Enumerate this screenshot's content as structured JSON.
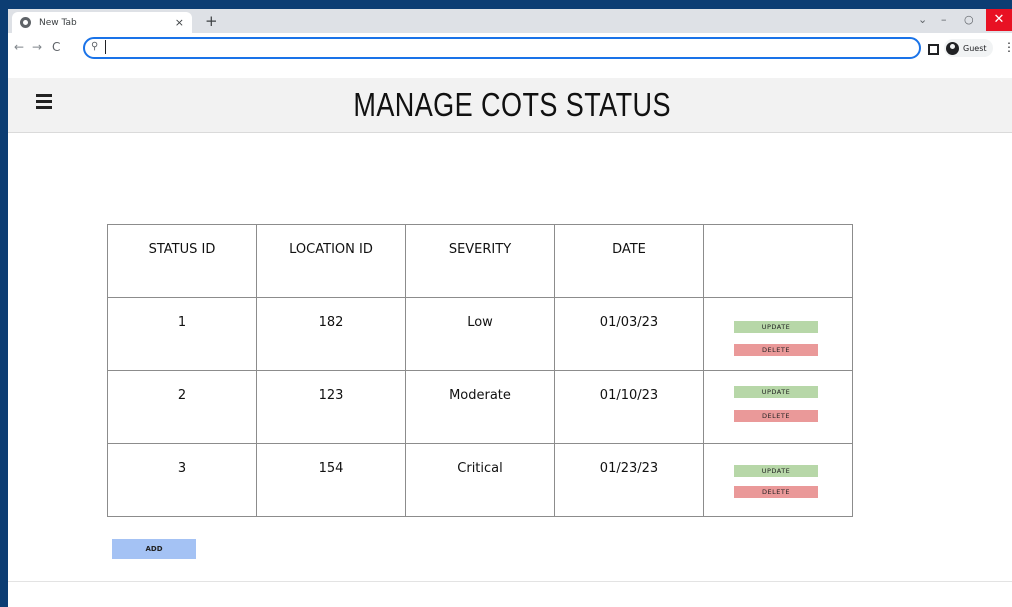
{
  "browser": {
    "tab_title": "New Tab",
    "tab_close": "×",
    "new_tab": "+",
    "omnibox_value": "",
    "profile_label": "Guest",
    "window_controls": {
      "chevron": "⌄",
      "minimize": "–",
      "restore": "○",
      "close": "✕"
    },
    "nav": {
      "back": "←",
      "forward": "→",
      "reload": "C"
    }
  },
  "header": {
    "title": "MANAGE COTS STATUS"
  },
  "table": {
    "columns": [
      "STATUS ID",
      "LOCATION ID",
      "SEVERITY",
      "DATE",
      ""
    ],
    "rows": [
      {
        "status_id": "1",
        "location_id": "182",
        "severity": "Low",
        "date": "01/03/23"
      },
      {
        "status_id": "2",
        "location_id": "123",
        "severity": "Moderate",
        "date": "01/10/23"
      },
      {
        "status_id": "3",
        "location_id": "154",
        "severity": "Critical",
        "date": "01/23/23"
      }
    ],
    "update_label": "UPDATE",
    "delete_label": "DELETE"
  },
  "add_label": "ADD",
  "colors": {
    "update": "#b7d7a8",
    "delete": "#ea9999",
    "add": "#a4c2f4",
    "header_bg": "#f2f2f2",
    "desktop": "#0c3d73"
  },
  "icons": [
    "globe-icon",
    "search-icon",
    "side-panel-icon",
    "profile-icon",
    "hamburger-menu-icon",
    "kebab-menu-icon"
  ]
}
